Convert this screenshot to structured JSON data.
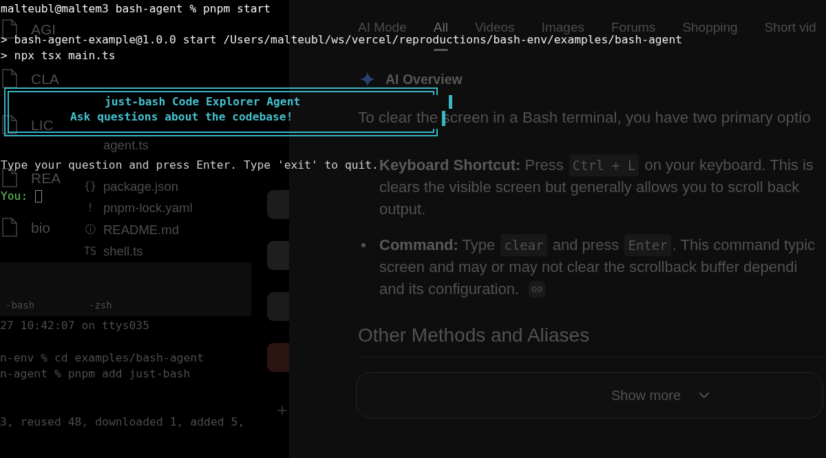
{
  "terminal": {
    "command": "malteubl@maltem3 bash-agent % pnpm start",
    "script_lines": [
      "> bash-agent-example@1.0.0 start /Users/malteubl/ws/vercel/reproductions/bash-env/examples/bash-agent",
      "> npx tsx main.ts"
    ],
    "banner": {
      "title": "just-bash Code Explorer Agent",
      "subtitle": "Ask questions about the codebase!"
    },
    "instructions": "Type your question and press Enter. Type 'exit' to quit.",
    "input_prompt": "You:"
  },
  "desktop": {
    "files": [
      "AGI",
      "CLA",
      "LIC",
      "REA",
      "bio"
    ]
  },
  "explorer": {
    "items": [
      {
        "name": "agent.ts"
      },
      {
        "glyph": "{}",
        "name": "package.json"
      },
      {
        "glyph": "!",
        "name": "pnpm-lock.yaml"
      },
      {
        "glyph": "ⓘ",
        "name": "README.md"
      },
      {
        "glyph": "TS",
        "name": "shell.ts"
      }
    ]
  },
  "background_terminal": {
    "tabs": [
      "-bash",
      "-zsh"
    ],
    "lines": [
      "27 10:42:07 on ttys035",
      "n-env % cd examples/bash-agent",
      "n-agent % pnpm add just-bash",
      "3, reused 48, downloaded 1, added 5,"
    ]
  },
  "search_page": {
    "tabs": [
      {
        "label": "AI Mode",
        "selected": false
      },
      {
        "label": "All",
        "selected": true
      },
      {
        "label": "Videos",
        "selected": false
      },
      {
        "label": "Images",
        "selected": false
      },
      {
        "label": "Forums",
        "selected": false
      },
      {
        "label": "Shopping",
        "selected": false
      },
      {
        "label": "Short vid",
        "selected": false
      }
    ],
    "overview_title": "AI Overview",
    "intro": "To clear the screen in a Bash terminal, you have two primary optio",
    "bullets": [
      {
        "marker": false,
        "citation": false,
        "lines": [
          [
            {
              "kind": "bold",
              "text": "Keyboard Shortcut:"
            },
            {
              "kind": "plain",
              "text": " Press "
            },
            {
              "kind": "code",
              "text": "Ctrl + L"
            },
            {
              "kind": "plain",
              "text": " on your keyboard. This is"
            }
          ],
          [
            {
              "kind": "plain",
              "text": "clears the visible screen but generally allows you to scroll back"
            }
          ],
          [
            {
              "kind": "plain",
              "text": "output."
            }
          ]
        ]
      },
      {
        "marker": true,
        "citation": true,
        "lines": [
          [
            {
              "kind": "bold",
              "text": "Command:"
            },
            {
              "kind": "plain",
              "text": " Type "
            },
            {
              "kind": "code",
              "text": "clear"
            },
            {
              "kind": "plain",
              "text": " and press "
            },
            {
              "kind": "code",
              "text": "Enter"
            },
            {
              "kind": "plain",
              "text": ". This command typic"
            }
          ],
          [
            {
              "kind": "plain",
              "text": "screen and may or may not clear the scrollback buffer dependi"
            }
          ],
          [
            {
              "kind": "plain",
              "text": "and its configuration."
            }
          ]
        ]
      }
    ],
    "heading": "Other Methods and Aliases",
    "show_more": "Show more"
  }
}
